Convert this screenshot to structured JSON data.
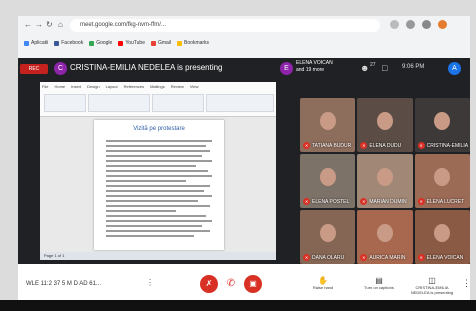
{
  "browser": {
    "nav_icons": [
      "back-icon",
      "forward-icon",
      "reload-icon",
      "home-icon"
    ],
    "url": "meet.google.com/fkg-nvm-ffm/...",
    "bookmarks": [
      {
        "label": "Aplicatii",
        "color": "#4285f4"
      },
      {
        "label": "Facebook",
        "color": "#3b5998"
      },
      {
        "label": "Google",
        "color": "#34a853"
      },
      {
        "label": "YouTube",
        "color": "#ff0000"
      },
      {
        "label": "Gmail",
        "color": "#ea4335"
      },
      {
        "label": "Bookmarks",
        "color": "#fbbc04"
      }
    ],
    "extension_icons": [
      "star-icon",
      "extension-icon",
      "menu-icon",
      "profile-icon"
    ]
  },
  "meet_top": {
    "recording_label": "REC",
    "presenter_avatar": "C",
    "presenter_title": "CRISTINA-EMILIA NEDELEA is presenting",
    "speaker_avatar": "E",
    "speaker_name": "ELENA VOICAN",
    "speaker_status": "and 19 more",
    "participants_count": "27",
    "time": "9:06 PM",
    "user_avatar": "A"
  },
  "shared_doc": {
    "ribbon_tabs": [
      "File",
      "Home",
      "Insert",
      "Design",
      "Layout",
      "References",
      "Mailings",
      "Review",
      "View"
    ],
    "title": "Vizită pe protestare",
    "status_text": "Page 1 of 1"
  },
  "participants": [
    {
      "name": "TATIANA BUDUR",
      "bg": "#8d6d5c"
    },
    {
      "name": "ELENA DUDU",
      "bg": "#5b4d45"
    },
    {
      "name": "CRISTINA-EMILIA",
      "bg": "#3d3938"
    },
    {
      "name": "ELENA POSTEL",
      "bg": "#7d7268"
    },
    {
      "name": "MARIAN DUMIN",
      "bg": "#a08776"
    },
    {
      "name": "ELENA LUCRET",
      "bg": "#9c6b56"
    },
    {
      "name": "DANA OLARU",
      "bg": "#856654"
    },
    {
      "name": "AURICA MARIN",
      "bg": "#a7684f"
    },
    {
      "name": "ELENA VOICAN",
      "bg": "#8b5a44"
    }
  ],
  "bottom": {
    "meeting_code": "WLE 11:2 37 5 M D AD 61...",
    "end_call_label": "Leave call",
    "raise_hand": "Raise hand",
    "captions": "Turn on captions",
    "presenting": "CRISTINA-EMILIA NEDELEA is presenting"
  },
  "colors": {
    "accent": "#1a73e8",
    "danger": "#d93025",
    "meet_bg": "#202124"
  }
}
